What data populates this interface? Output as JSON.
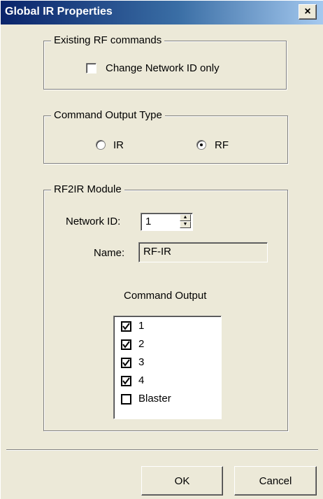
{
  "window": {
    "title": "Global IR Properties",
    "close_glyph": "×"
  },
  "existing_rf": {
    "group_label": "Existing RF commands",
    "change_network_label": "Change Network ID only",
    "change_network_checked": false
  },
  "command_output_type": {
    "group_label": "Command Output Type",
    "options": [
      {
        "label": "IR",
        "selected": false
      },
      {
        "label": "RF",
        "selected": true
      }
    ]
  },
  "rf2ir": {
    "group_label": "RF2IR Module",
    "network_id_label": "Network ID:",
    "network_id_value": "1",
    "name_label": "Name:",
    "name_value": "RF-IR",
    "command_output_label": "Command Output",
    "outputs": [
      {
        "label": "1",
        "checked": true
      },
      {
        "label": "2",
        "checked": true
      },
      {
        "label": "3",
        "checked": true
      },
      {
        "label": "4",
        "checked": true
      },
      {
        "label": "Blaster",
        "checked": false
      }
    ]
  },
  "buttons": {
    "ok": "OK",
    "cancel": "Cancel"
  }
}
